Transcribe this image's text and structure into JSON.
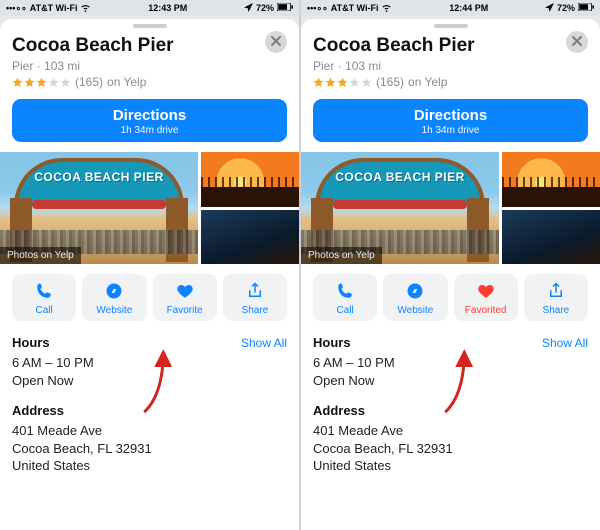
{
  "screens": [
    {
      "status": {
        "carrier": "AT&T Wi-Fi",
        "time": "12:43 PM",
        "battery": "72%"
      },
      "favorite": {
        "label": "Favorite",
        "on": false
      }
    },
    {
      "status": {
        "carrier": "AT&T Wi-Fi",
        "time": "12:44 PM",
        "battery": "72%"
      },
      "favorite": {
        "label": "Favorited",
        "on": true
      }
    }
  ],
  "place": {
    "name": "Cocoa Beach Pier",
    "category": "Pier",
    "distance": "103 mi",
    "rating_stars": 3,
    "review_count": "(165)",
    "review_source": "on Yelp",
    "photo_badge": "Photos on Yelp",
    "photo_arch_text": "COCOA BEACH PIER"
  },
  "directions": {
    "label": "Directions",
    "eta": "1h 34m drive"
  },
  "actions": {
    "call": "Call",
    "website": "Website",
    "share": "Share"
  },
  "hours": {
    "title": "Hours",
    "show_all": "Show All",
    "range": "6 AM – 10 PM",
    "open_now": "Open Now"
  },
  "address": {
    "title": "Address",
    "line1": "401 Meade Ave",
    "line2": "Cocoa Beach, FL  32931",
    "line3": "United States"
  },
  "colors": {
    "accent": "#0a84ff",
    "favorite_on": "#ff3b30",
    "star_on": "#f5a623"
  }
}
